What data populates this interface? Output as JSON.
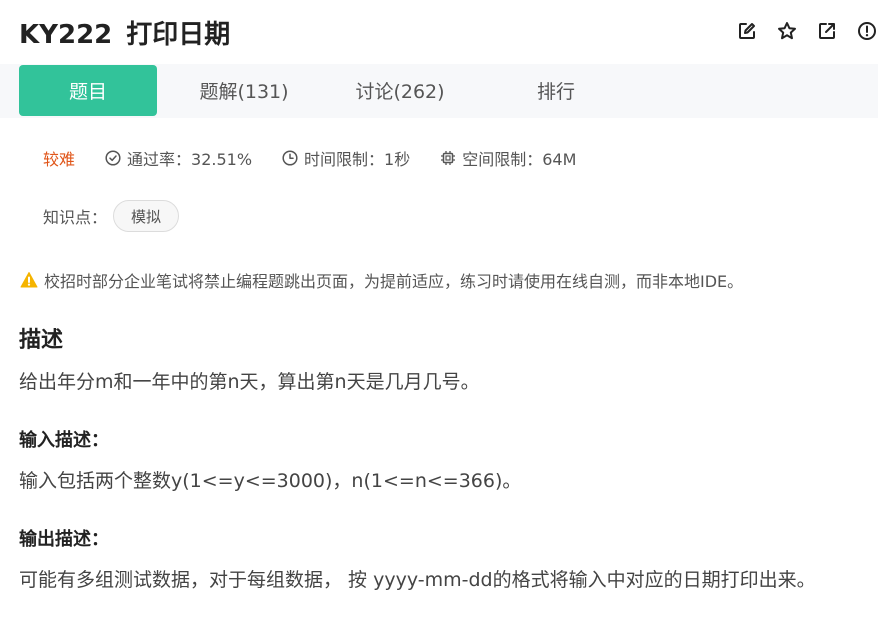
{
  "header": {
    "id": "KY222",
    "title": "打印日期",
    "icons": [
      "edit-icon",
      "star-icon",
      "external-link-icon",
      "alert-circle-icon"
    ]
  },
  "tabs": [
    {
      "label": "题目",
      "active": true
    },
    {
      "label": "题解(131)",
      "active": false
    },
    {
      "label": "讨论(262)",
      "active": false
    },
    {
      "label": "排行",
      "active": false
    }
  ],
  "meta": {
    "difficulty": "较难",
    "pass_rate": "通过率：32.51%",
    "time_limit": "时间限制：1秒",
    "space_limit": "空间限制：64M"
  },
  "knowledge": {
    "label": "知识点：",
    "tag": "模拟"
  },
  "notice": "校招时部分企业笔试将禁止编程题跳出页面，为提前适应，练习时请使用在线自测，而非本地IDE。",
  "description": {
    "heading": "描述",
    "text": "给出年分m和一年中的第n天，算出第n天是几月几号。"
  },
  "input_desc": {
    "heading": "输入描述：",
    "text": "输入包括两个整数y(1<=y<=3000)，n(1<=n<=366)。"
  },
  "output_desc": {
    "heading": "输出描述：",
    "text": "可能有多组测试数据，对于每组数据， 按 yyyy-mm-dd的格式将输入中对应的日期打印出来。"
  },
  "colors": {
    "accent": "#32c39a",
    "difficulty": "#e0561a",
    "warning": "#f5b400"
  }
}
